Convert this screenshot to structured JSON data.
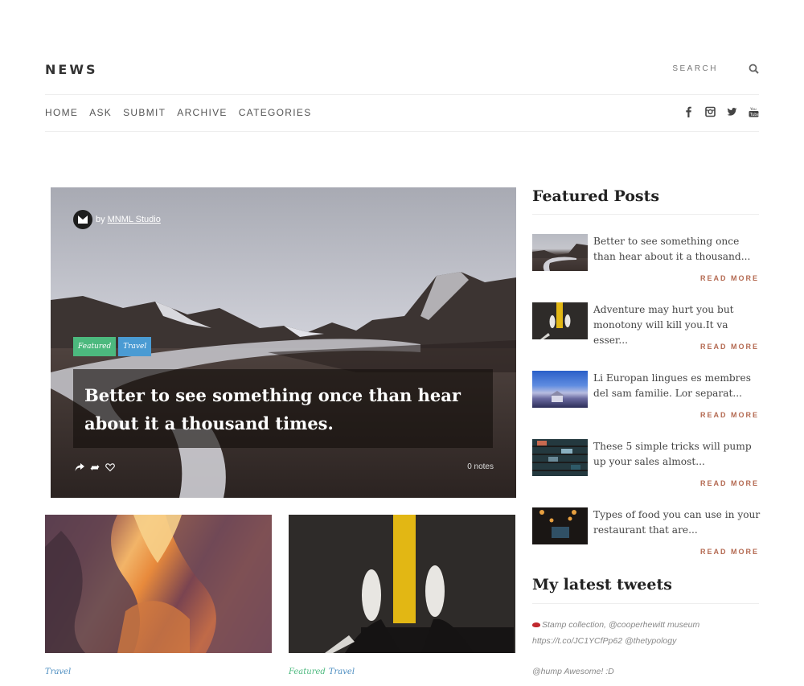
{
  "header": {
    "logo": "NEWS",
    "search_label": "SEARCH",
    "nav": [
      "HOME",
      "ASK",
      "SUBMIT",
      "ARCHIVE",
      "CATEGORIES"
    ],
    "social_icons": [
      "facebook-icon",
      "instagram-icon",
      "twitter-icon",
      "youtube-icon"
    ]
  },
  "hero": {
    "author_prefix": "by",
    "author_name": "MNML Studio",
    "tags": [
      "Featured",
      "Travel"
    ],
    "title": "Better to see something once than hear about it a thousand times.",
    "notes": "0 notes",
    "actions": [
      "share-icon",
      "reblog-icon",
      "like-icon"
    ]
  },
  "cards": [
    {
      "category": "Travel"
    },
    {
      "categories": [
        "Featured",
        "Travel"
      ]
    }
  ],
  "sidebar": {
    "featured_title": "Featured Posts",
    "read_more": "READ MORE",
    "posts": [
      {
        "text": "Better to see something once than hear about it a thousand..."
      },
      {
        "text": "Adventure may hurt you but monotony will kill you.It va esser..."
      },
      {
        "text": "Li Europan lingues es membres del sam familie. Lor separat..."
      },
      {
        "text": "These 5 simple tricks will pump up your sales almost..."
      },
      {
        "text": "Types of food you can use in your restaurant that are..."
      }
    ],
    "tweets_title": "My latest tweets",
    "tweets": [
      {
        "line1": "Stamp collection, @cooperhewitt museum",
        "line2": "https://t.co/JC1YCfPp62 @thetypology"
      },
      {
        "line1": "@hump Awesome! :D"
      }
    ]
  },
  "colors": {
    "tag_featured": "#4cb97e",
    "tag_travel": "#4a9bd3",
    "read_more": "#b46a52"
  }
}
